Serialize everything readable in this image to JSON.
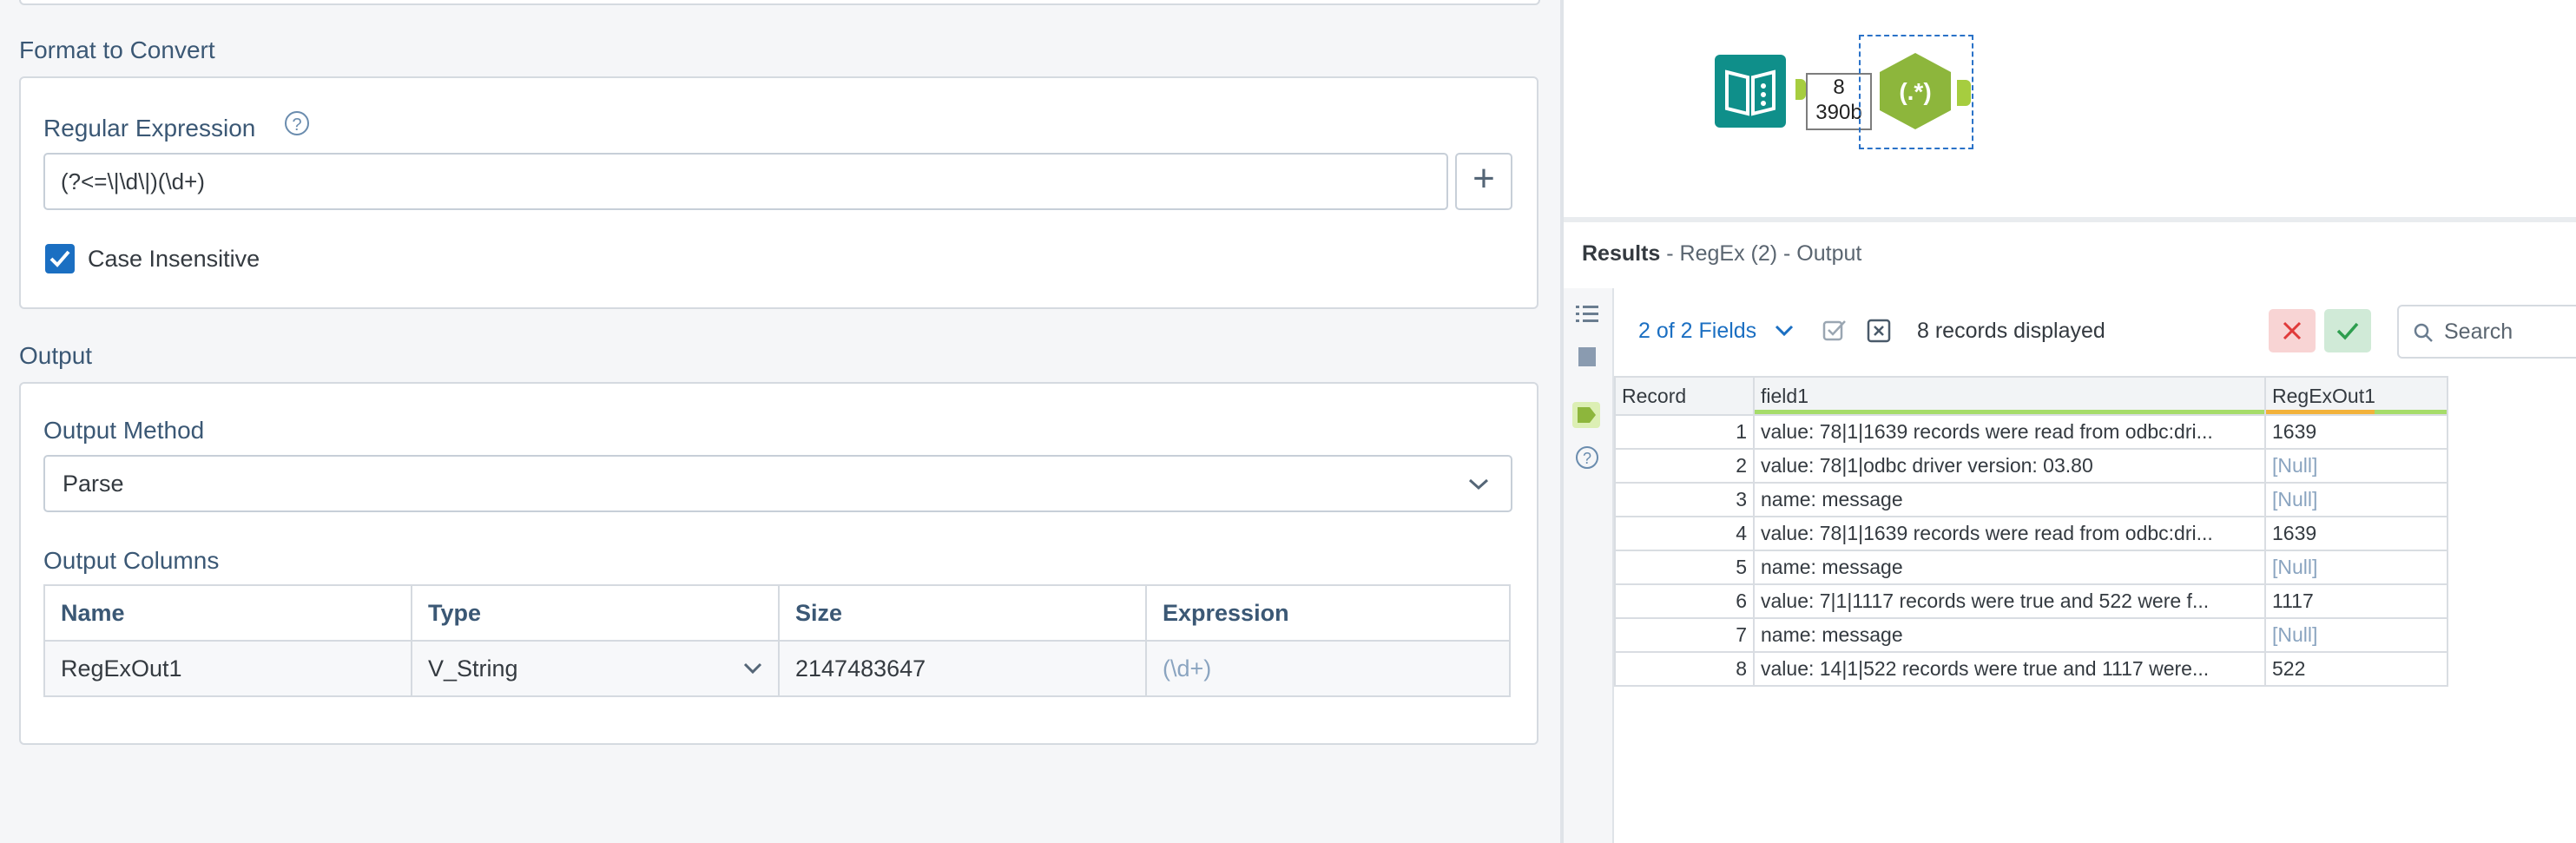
{
  "config": {
    "format_section_title": "Format to Convert",
    "regex_label": "Regular Expression",
    "regex_value": "(?<=\\|\\d\\|)(\\d+)",
    "case_insensitive_label": "Case Insensitive",
    "case_insensitive_checked": true,
    "output_section_title": "Output",
    "output_method_label": "Output Method",
    "output_method_value": "Parse",
    "output_columns_label": "Output Columns",
    "columns_headers": [
      "Name",
      "Type",
      "Size",
      "Expression"
    ],
    "columns_row": {
      "name": "RegExOut1",
      "type": "V_String",
      "size": "2147483647",
      "expression": "(\\d+)"
    }
  },
  "canvas": {
    "connection_count": "8",
    "connection_size": "390b",
    "regex_tool_glyph": "(.*)",
    "input_tool_icon": "book-icon"
  },
  "results": {
    "title": "Results",
    "subtitle": " - RegEx (2) - Output",
    "fields_selector": "2 of 2 Fields",
    "records_displayed": "8 records displayed",
    "search_placeholder": "Search",
    "headers": [
      "Record",
      "field1",
      "RegExOut1"
    ],
    "rows": [
      {
        "record": "1",
        "field1": "value: 78|1|1639 records were read from odbc:dri...",
        "out": "1639"
      },
      {
        "record": "2",
        "field1": "value: 78|1|odbc driver version: 03.80",
        "out": "[Null]"
      },
      {
        "record": "3",
        "field1": "name: message",
        "out": "[Null]"
      },
      {
        "record": "4",
        "field1": "value: 78|1|1639 records were read from odbc:dri...",
        "out": "1639"
      },
      {
        "record": "5",
        "field1": "name: message",
        "out": "[Null]"
      },
      {
        "record": "6",
        "field1": "value: 7|1|1117 records were true and 522 were f...",
        "out": "1117"
      },
      {
        "record": "7",
        "field1": "name: message",
        "out": "[Null]"
      },
      {
        "record": "8",
        "field1": "value: 14|1|522 records were true and 1117 were...",
        "out": "522"
      }
    ]
  },
  "colors": {
    "accent": "#1b6fc2",
    "label": "#3b5875",
    "tool_teal": "#0f8f8a",
    "tool_green": "#8db63c",
    "anchor_green": "#a6cd3f"
  }
}
